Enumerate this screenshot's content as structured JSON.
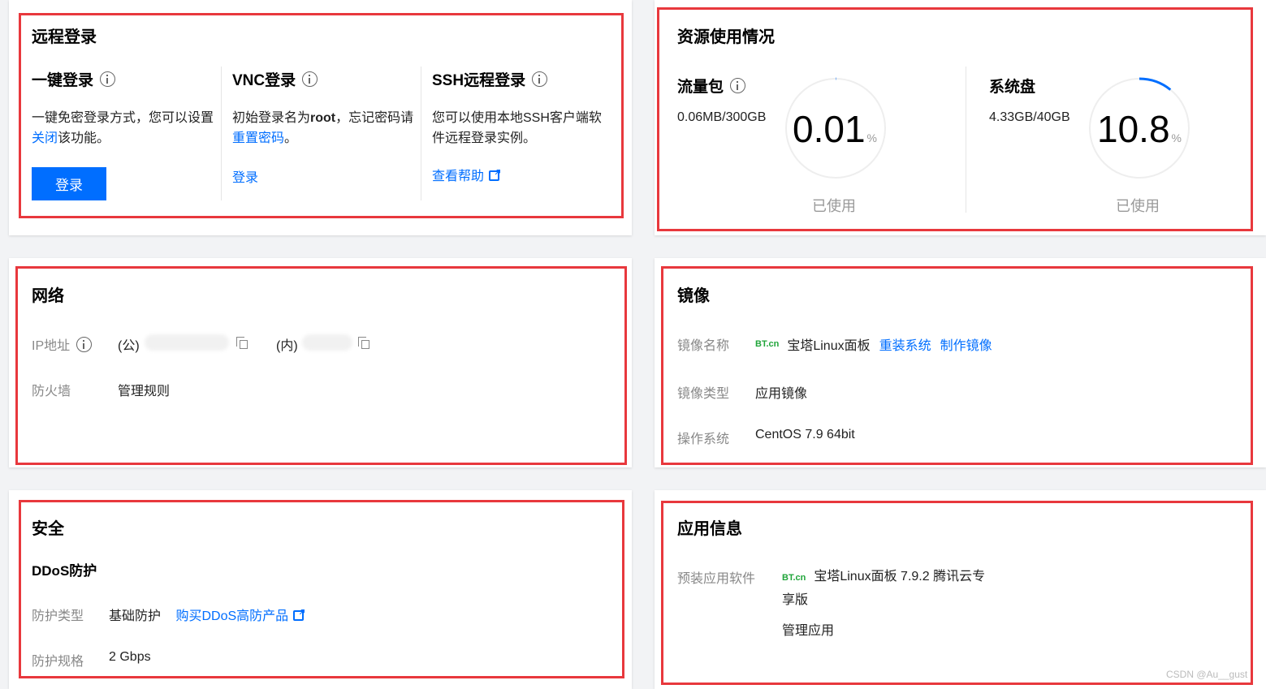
{
  "remote_login": {
    "title": "远程登录",
    "one_click": {
      "title": "一键登录",
      "desc_1": "一键免密登录方式，您可以设置",
      "desc_link": "关闭",
      "desc_2": "该功能。",
      "button": "登录"
    },
    "vnc": {
      "title": "VNC登录",
      "desc_1": "初始登录名为",
      "desc_bold": "root",
      "desc_2": "，忘记密码请",
      "desc_link": "重置密码",
      "desc_3": "。",
      "link": "登录"
    },
    "ssh": {
      "title": "SSH远程登录",
      "desc": "您可以使用本地SSH客户端软件远程登录实例。",
      "link": "查看帮助"
    }
  },
  "resource": {
    "title": "资源使用情况",
    "traffic": {
      "title": "流量包",
      "usage": "0.06MB/300GB",
      "percent": "0.01",
      "unit": "%",
      "fraction": 0.0001,
      "used_label": "已使用"
    },
    "disk": {
      "title": "系统盘",
      "usage": "4.33GB/40GB",
      "percent": "10.8",
      "unit": "%",
      "fraction": 0.108,
      "used_label": "已使用"
    }
  },
  "network": {
    "title": "网络",
    "ip_label": "IP地址",
    "public_prefix": "(公)",
    "private_prefix": "(内)",
    "firewall_label": "防火墙",
    "firewall_link": "管理规则"
  },
  "image": {
    "title": "镜像",
    "name_label": "镜像名称",
    "bt_logo": "BT.cn",
    "name_value": "宝塔Linux面板",
    "reinstall_link": "重装系统",
    "make_image_link": "制作镜像",
    "type_label": "镜像类型",
    "type_value": "应用镜像",
    "os_label": "操作系统",
    "os_value": "CentOS 7.9 64bit"
  },
  "security": {
    "title": "安全",
    "ddos_title": "DDoS防护",
    "type_label": "防护类型",
    "type_value": "基础防护",
    "buy_link": "购买DDoS高防产品",
    "spec_label": "防护规格",
    "spec_value": "2 Gbps"
  },
  "app_info": {
    "title": "应用信息",
    "software_label": "预装应用软件",
    "bt_logo": "BT.cn",
    "software_line1": "宝塔Linux面板 7.9.2 腾讯云专",
    "software_line2": "享版",
    "manage_link": "管理应用"
  },
  "watermark": "CSDN @Au__gust",
  "colors": {
    "accent": "#006eff",
    "highlight": "#e8383d",
    "ring_track": "#eeeeee"
  }
}
